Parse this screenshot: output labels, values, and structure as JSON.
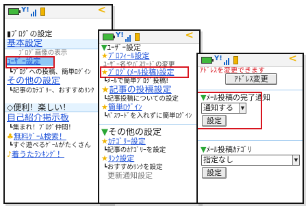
{
  "screen1": {
    "blog_settings_heading": "ﾌﾞﾛｸﾞの設定",
    "basic_settings": "基本設定",
    "partial_blog_image_text": "ﾌﾞﾛｸﾞ画像の表示",
    "user_settings": "ﾕｰｻﾞｰ設定",
    "user_settings_note": "┗ﾌﾞﾛｸﾞへの投稿、簡単ﾛｸﾞｲﾝ",
    "other_settings": "その他の設定",
    "other_settings_note": "┗記事のｶﾃｺﾞﾘｰ、おすすめﾘﾝｸ",
    "fun_heading": "◇便利！楽しい！",
    "intro_board": "自己紹介掲示板",
    "intro_board_note": "┗集まれ！ﾌﾞﾛｸﾞ仲間！",
    "free_game": "無料ｹﾞｰﾑ検索！",
    "free_game_note": "┗すぐ遊べるｹﾞｰﾑがたくさん",
    "ranking": "着うたﾗﾝｷﾝｸﾞ！"
  },
  "screen2": {
    "user_settings_heading": "ﾕｰｻﾞｰ設定",
    "profile_settings": "ﾌﾟﾛﾌｨｰﾙ設定",
    "username_change": "ﾕｰｻﾞｰ名やﾊﾟｽﾜｰﾄﾞの変更",
    "blog_mail_settings": "ﾌﾞﾛｸﾞ(ﾒｰﾙ投稿)設定",
    "blog_mail_note": "┗ﾒｰﾙで簡単ﾌﾞﾛｸﾞ投稿!",
    "post_settings": "記事の投稿設定",
    "post_settings_note": "┗記事投稿についての設定",
    "easy_login": "簡単ﾛｸﾞｲﾝ",
    "easy_login_note": "┗ﾊﾟｽﾜｰﾄﾞを入れずに簡単ﾛｸﾞｲﾝ",
    "other_settings_heading": "その他の設定",
    "category_settings": "ｶﾃｺﾞﾘｰ設定",
    "category_note": "┗記事のｶﾃｺﾞﾘｰを設定",
    "link_settings": "ﾘﾝｸ設定",
    "link_note": "┗おすすめﾘﾝｸを設定",
    "partial_bottom": "更新通知設定"
  },
  "screen3": {
    "partial_top": "ｱﾄﾞﾚｽを変更できます",
    "address_change_button": "ｱﾄﾞﾚｽ変更",
    "notify_heading": "ﾒｰﾙ投稿の完了通知",
    "notify_select_value": "通知する",
    "settings_button_1": "設定",
    "category_heading": "ﾒｰﾙ投稿ｶﾃｺﾞﾘ",
    "category_select_value": "指定なし",
    "settings_button_2": "設定"
  },
  "status": {
    "signal_text": "Y!"
  },
  "colors": {
    "link": "#1b4fd8",
    "highlight": "#d8141e",
    "header_bg": "#e4f3ff",
    "selection": "#8ec8f5"
  }
}
